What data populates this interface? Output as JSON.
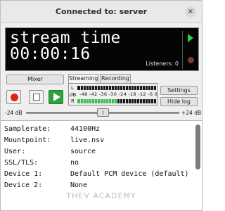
{
  "window": {
    "title": "Connected to: server",
    "close_glyph": "×"
  },
  "display": {
    "line1": "stream time",
    "line2": "00:00:16",
    "listeners": "Listeners: 0",
    "play_indicator_color": "#2bd14a",
    "record_indicator_color": "#7a3a36"
  },
  "controls": {
    "mixer_label": "Mixer",
    "record_icon": "record-icon",
    "stop_icon": "stop-icon",
    "play_icon": "play-icon",
    "settings_label": "Settings",
    "hide_log_label": "Hide log"
  },
  "tabs": [
    {
      "label": "Streaming",
      "selected": true
    },
    {
      "label": "Recording",
      "selected": false
    }
  ],
  "meter": {
    "left_label": "L",
    "db_label": "dB",
    "right_label": "R",
    "scale": "-48 -42 -36 -30 -24 -18 -12 -6  0",
    "left_level": 0.0,
    "right_level": 0.5,
    "fill_color": "#3bc24d"
  },
  "volume": {
    "min_label": "-24 dB",
    "max_label": "+24 dB",
    "value_db": 0
  },
  "log": {
    "rows": [
      {
        "key": "Samplerate:",
        "value": "44100Hz"
      },
      {
        "key": "Mountpoint:",
        "value": "live.nsv"
      },
      {
        "key": "User:",
        "value": "source"
      },
      {
        "key": "SSL/TLS:",
        "value": "no"
      },
      {
        "key": "Device 1:",
        "value": "Default PCM device (default)"
      },
      {
        "key": "Device 2:",
        "value": "None"
      }
    ],
    "watermark": "THEV ACADEMY"
  }
}
